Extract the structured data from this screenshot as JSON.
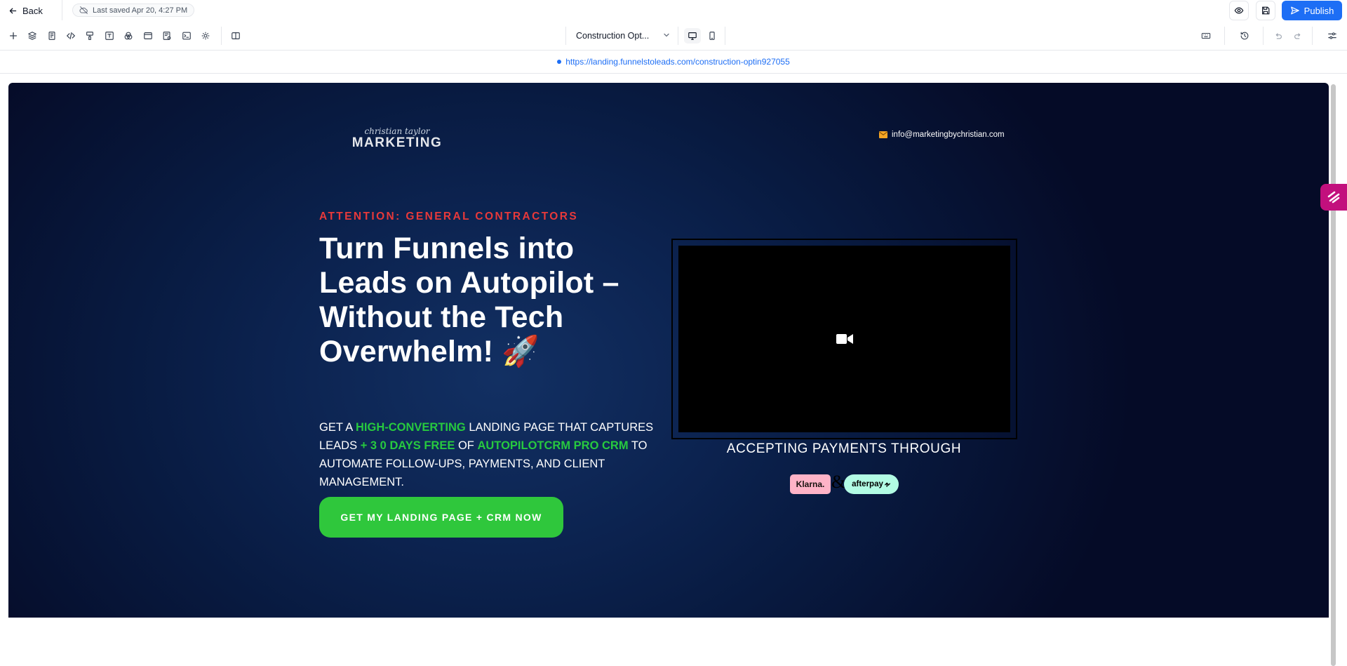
{
  "header": {
    "back_label": "Back",
    "last_saved": "Last saved Apr 20, 4:27 PM",
    "publish_label": "Publish"
  },
  "toolbar": {
    "left_tools": [
      "add-icon",
      "layers-icon",
      "page-icon",
      "code-icon",
      "paint-icon",
      "text-icon",
      "shapes-icon",
      "browser-icon",
      "form-icon",
      "terminal-icon",
      "settings-icon",
      "split-view-icon"
    ],
    "page_selector": "Construction Opt...",
    "devices": [
      "desktop-icon",
      "mobile-icon"
    ],
    "right_tools": [
      "keyboard-icon",
      "history-icon",
      "undo-icon",
      "redo-icon",
      "sliders-icon"
    ]
  },
  "url": {
    "text": "https://landing.funnelstoleads.com/construction-optin927055"
  },
  "hero": {
    "logo_script": "christian taylor",
    "logo_text": "MARKETING",
    "email": "info@marketingbychristian.com",
    "eyebrow": "ATTENTION: GENERAL CONTRACTORS",
    "headline": "Turn Funnels into Leads on Autopilot – Without the Tech Overwhelm! 🚀",
    "sub_1": "GET A ",
    "sub_hl_1": "HIGH-CONVERTING",
    "sub_2": " LANDING PAGE THAT CAPTURES LEADS ",
    "sub_hl_2": "+ 3 0 DAYS FREE",
    "sub_3": " OF ",
    "sub_hl_3": "AUTOPILOTCRM PRO CRM",
    "sub_4": " TO AUTOMATE FOLLOW-UPS, PAYMENTS, AND CLIENT MANAGEMENT.",
    "cta": "GET MY LANDING PAGE + CRM NOW",
    "payments_label": "ACCEPTING PAYMENTS THROUGH",
    "klarna": "Klarna.",
    "ampersand": "&",
    "afterpay": "afterpay"
  },
  "colors": {
    "accent": "#1d6ef5",
    "eyebrow": "#e8393a",
    "highlight": "#27c93f",
    "cta": "#2fc73c",
    "hero_bg": "#081a40",
    "float_tab": "#c2107d"
  }
}
